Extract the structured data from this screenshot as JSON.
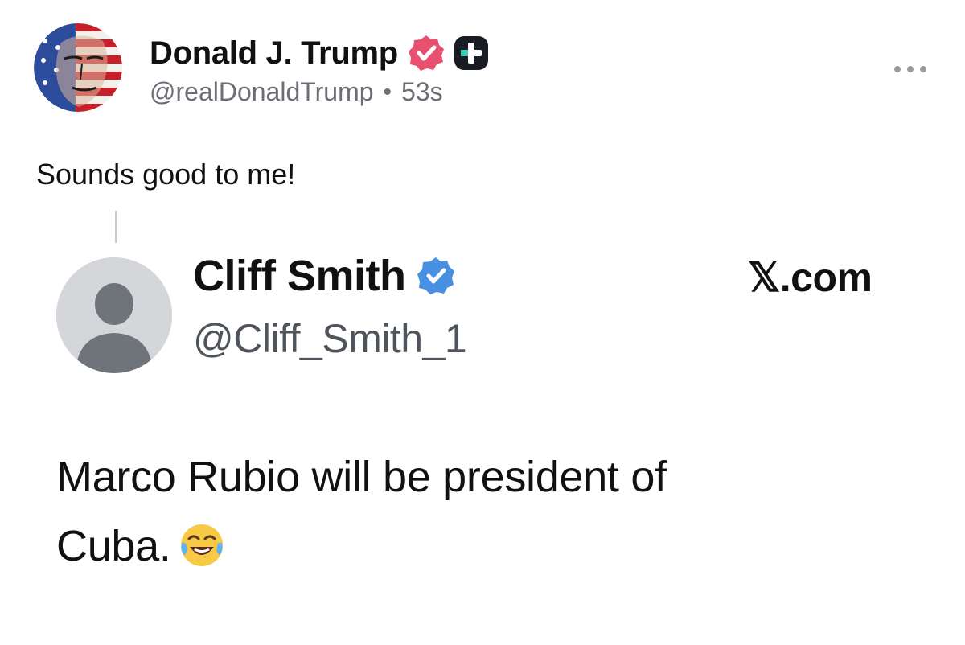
{
  "post": {
    "author": {
      "display_name": "Donald J. Trump",
      "handle": "@realDonaldTrump",
      "verified": true,
      "badge_color": "#e8506f",
      "plus_badge_color": "#1a1c23"
    },
    "separator": "•",
    "timestamp": "53s",
    "text": "Sounds good to me!",
    "more_icon": "more-horizontal-icon"
  },
  "quoted": {
    "author": {
      "display_name": "Cliff Smith",
      "handle": "@Cliff_Smith_1",
      "verified": true,
      "badge_color": "#4a90e2"
    },
    "site": "𝕏.com",
    "text_lines": [
      "Marco Rubio will be president of",
      "Cuba."
    ],
    "emoji": "face-with-tears-of-joy-icon"
  }
}
